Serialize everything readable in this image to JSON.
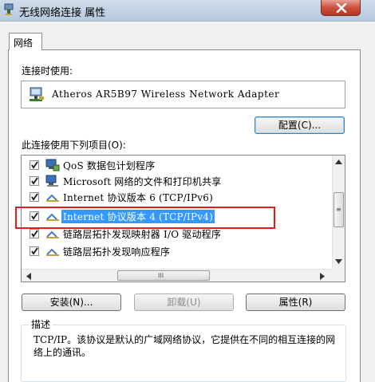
{
  "window": {
    "title": "无线网络连接 属性",
    "close_icon": "close-icon"
  },
  "tabs": [
    {
      "label": "网络",
      "active": true
    }
  ],
  "connect_using": {
    "label": "连接时使用:",
    "adapter_name": "Atheros AR5B97 Wireless Network Adapter",
    "configure_label": "配置(C)..."
  },
  "items_section": {
    "label": "此连接使用下列项目(O):",
    "items": [
      {
        "label": "QoS 数据包计划程序",
        "checked": true,
        "icon": "qos-icon"
      },
      {
        "label": "Microsoft 网络的文件和打印机共享",
        "checked": true,
        "icon": "network-share-icon"
      },
      {
        "label": "Internet 协议版本 6 (TCP/IPv6)",
        "checked": true,
        "icon": "protocol-icon"
      },
      {
        "label": "Internet 协议版本 4 (TCP/IPv4)",
        "checked": true,
        "icon": "protocol-icon",
        "selected": true
      },
      {
        "label": "链路层拓扑发现映射器 I/O 驱动程序",
        "checked": true,
        "icon": "protocol-icon"
      },
      {
        "label": "链路层拓扑发现响应程序",
        "checked": true,
        "icon": "protocol-icon"
      }
    ],
    "hscroll_grip": "III",
    "vscroll_grip": "≡"
  },
  "buttons": {
    "install": "安装(N)...",
    "uninstall": "卸载(U)",
    "properties": "属性(R)"
  },
  "description": {
    "title": "描述",
    "text": "TCP/IP。该协议是默认的广域网络协议，它提供在不同的相互连接的网络上的通讯。"
  },
  "colors": {
    "selection": "#3399ff",
    "highlight_box": "#e02020",
    "titlebar": "#b7c9de",
    "close_button": "#c9513f"
  }
}
